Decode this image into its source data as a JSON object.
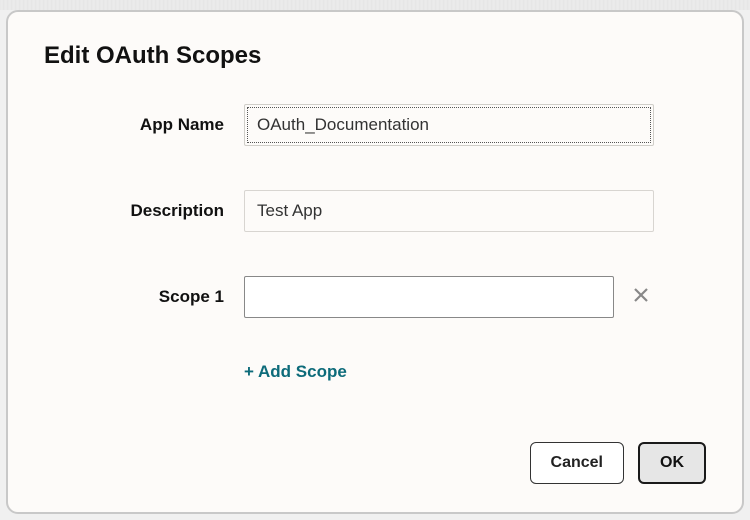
{
  "dialog": {
    "title": "Edit OAuth Scopes"
  },
  "form": {
    "appName": {
      "label": "App Name",
      "value": "OAuth_Documentation"
    },
    "description": {
      "label": "Description",
      "value": "Test App"
    },
    "scope1": {
      "label": "Scope 1",
      "value": ""
    },
    "addScope": {
      "label": "+ Add Scope"
    }
  },
  "buttons": {
    "cancel": "Cancel",
    "ok": "OK"
  }
}
